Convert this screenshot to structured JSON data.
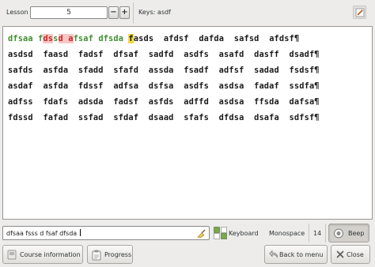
{
  "toolbar": {
    "lesson_label": "Lesson",
    "lesson_value": "5",
    "minus": "−",
    "plus": "+",
    "keys_label": "Keys: asdf"
  },
  "exercise": {
    "line1": {
      "typed_a": "dfsaa f",
      "err_a": "ds",
      "typed_b": "s",
      "err_b": "d a",
      "typed_c": "fsaf dfsda ",
      "cursor": "f",
      "rest": "asds  afdsf  dafda  safsd  afdsf¶"
    },
    "lines": [
      "asdsd  faasd  fadsf  dfsaf  sadfd  asdfs  asafd  dasff  dsadf¶",
      "safds  asfda  sfadd  sfafd  assda  fsadf  adfsf  sadad  fsdsf¶",
      "asdaf  asfda  fdssf  adfsa  dsfsa  asdfs  asdsa  fadaf  ssdfa¶",
      "adfss  fdafs  adsda  fadsf  asfds  adffd  asdsa  ffsda  dafsa¶",
      "fdssd  fafad  ssfad  sfdaf  dsaad  sfafs  dfdsa  dsafa  sdfsf¶"
    ]
  },
  "input": {
    "value": "dfsaa fsss d fsaf dfsda "
  },
  "status": {
    "keyboard_label": "Keyboard",
    "font_label": "Monospace",
    "size_label": "14",
    "beep_label": "Beep"
  },
  "buttons": {
    "course_info": "Course information",
    "progress": "Progress",
    "back_to_menu": "Back to menu",
    "close": "Close"
  },
  "colors": {
    "typed": "#3f8f2f",
    "error": "#cc2222",
    "error_bg": "#f7c6c6",
    "cursor_bg": "#f3da42"
  }
}
